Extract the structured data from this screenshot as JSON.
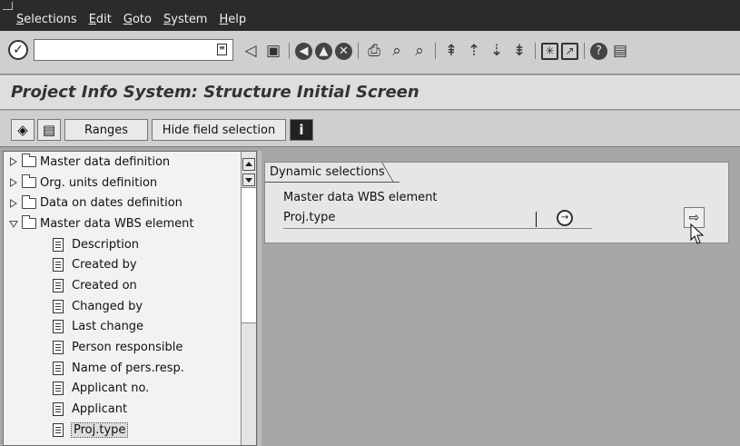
{
  "menubar": {
    "items": [
      "Selections",
      "Edit",
      "Goto",
      "System",
      "Help"
    ]
  },
  "system_toolbar": {
    "command_field_value": "",
    "icons": [
      "enter-icon",
      "save-icon",
      "back-icon",
      "exit-icon",
      "cancel-icon",
      "print-icon",
      "find-icon",
      "find-next-icon",
      "first-page-icon",
      "previous-page-icon",
      "next-page-icon",
      "last-page-icon",
      "create-session-icon",
      "shortcut-icon",
      "help-icon",
      "layout-menu-icon"
    ]
  },
  "title": "Project Info System: Structure Initial Screen",
  "app_toolbar": {
    "ranges_label": "Ranges",
    "hide_field_selection_label": "Hide field selection"
  },
  "tree": {
    "folders_collapsed": [
      "Master data definition",
      "Org. units definition",
      "Data on dates definition"
    ],
    "folder_expanded": "Master data WBS element",
    "items": [
      "Description",
      "Created by",
      "Created on",
      "Changed by",
      "Last change",
      "Person responsible",
      "Name of pers.resp.",
      "Applicant no.",
      "Applicant",
      "Proj.type"
    ],
    "selected_item": "Proj.type"
  },
  "dynamic_selections": {
    "tab_label": "Dynamic selections",
    "group_label": "Master data WBS element",
    "field_label": "Proj.type",
    "field_value": ""
  }
}
